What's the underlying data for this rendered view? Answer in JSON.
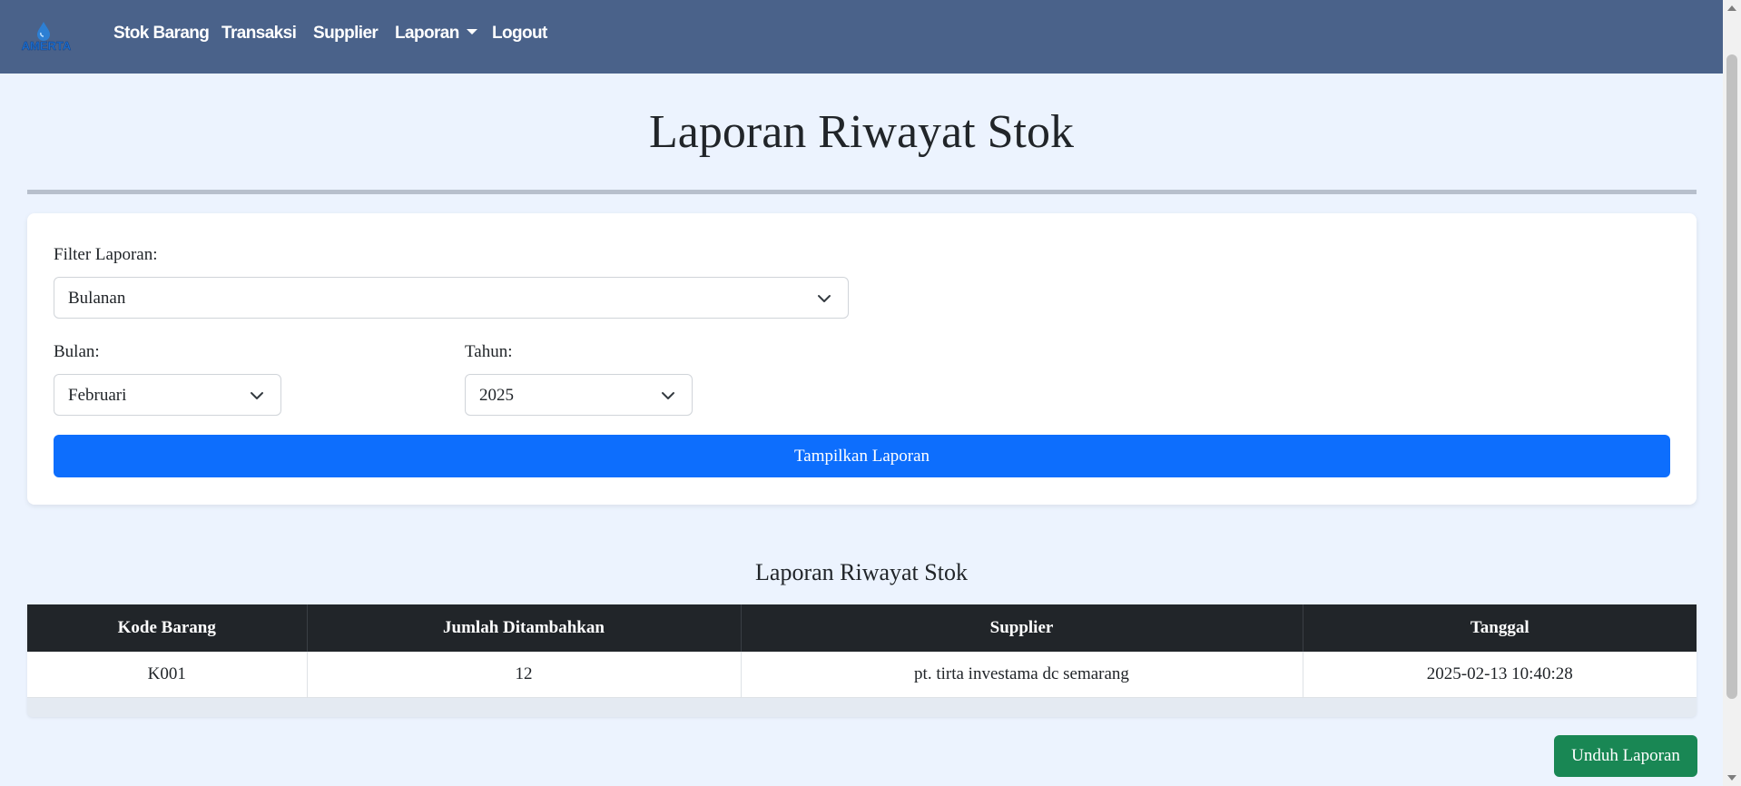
{
  "brand": {
    "logo_text": "AMERTA",
    "icon": "water-drop-logo"
  },
  "nav": {
    "stok_barang": "Stok Barang",
    "transaksi": "Transaksi",
    "supplier": "Supplier",
    "laporan": "Laporan",
    "logout": "Logout"
  },
  "page": {
    "title": "Laporan Riwayat Stok"
  },
  "filter": {
    "label": "Filter Laporan:",
    "value": "Bulanan",
    "bulan_label": "Bulan:",
    "bulan_value": "Februari",
    "tahun_label": "Tahun:",
    "tahun_value": "2025",
    "submit_label": "Tampilkan Laporan"
  },
  "report": {
    "title": "Laporan Riwayat Stok",
    "columns": [
      "Kode Barang",
      "Jumlah Ditambahkan",
      "Supplier",
      "Tanggal"
    ],
    "rows": [
      [
        "K001",
        "12",
        "pt. tirta investama dc semarang",
        "2025-02-13 10:40:28"
      ]
    ],
    "download_label": "Unduh Laporan"
  },
  "colors": {
    "navbar": "#4a628a",
    "background": "#ecf3fe",
    "primary": "#0d6efd",
    "success": "#198754",
    "table_header": "#212529"
  }
}
